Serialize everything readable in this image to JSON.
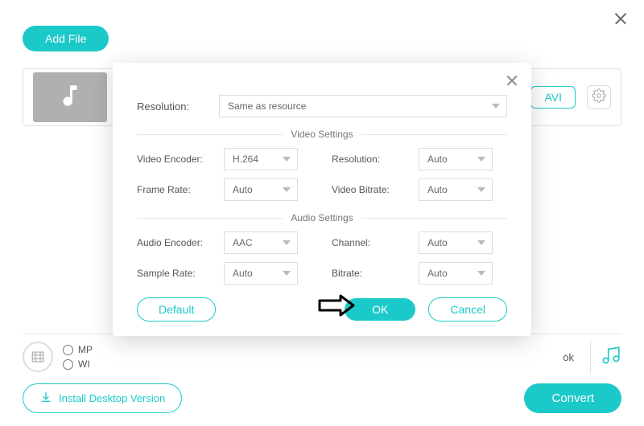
{
  "window": {
    "add_file_label": "Add File"
  },
  "file_row": {
    "format_btn": "AVI"
  },
  "bottom": {
    "radio1": "MP",
    "radio2": "WI",
    "ok_text": "ok"
  },
  "footer": {
    "install_label": "Install Desktop Version",
    "convert_label": "Convert"
  },
  "modal": {
    "resolution_label": "Resolution:",
    "resolution_value": "Same as resource",
    "video_section_title": "Video Settings",
    "audio_section_title": "Audio Settings",
    "video": {
      "encoder_label": "Video Encoder:",
      "encoder_value": "H.264",
      "resolution_label": "Resolution:",
      "resolution_value": "Auto",
      "framerate_label": "Frame Rate:",
      "framerate_value": "Auto",
      "bitrate_label": "Video Bitrate:",
      "bitrate_value": "Auto"
    },
    "audio": {
      "encoder_label": "Audio Encoder:",
      "encoder_value": "AAC",
      "channel_label": "Channel:",
      "channel_value": "Auto",
      "samplerate_label": "Sample Rate:",
      "samplerate_value": "Auto",
      "bitrate_label": "Bitrate:",
      "bitrate_value": "Auto"
    },
    "default_btn": "Default",
    "ok_btn": "OK",
    "cancel_btn": "Cancel"
  }
}
